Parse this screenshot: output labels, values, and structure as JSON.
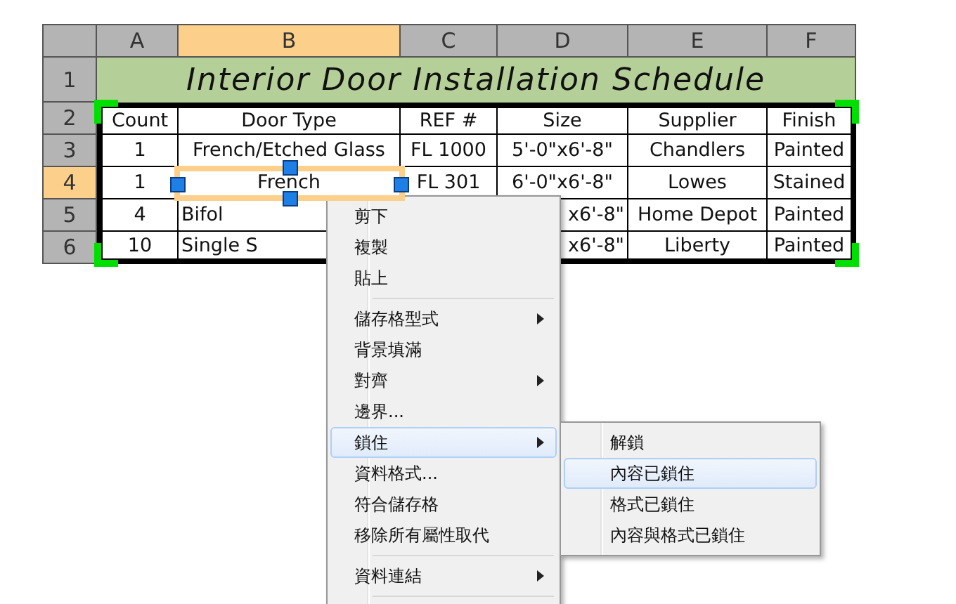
{
  "columns": [
    {
      "label": "A",
      "selected": false
    },
    {
      "label": "B",
      "selected": true
    },
    {
      "label": "C",
      "selected": false
    },
    {
      "label": "D",
      "selected": false
    },
    {
      "label": "E",
      "selected": false
    },
    {
      "label": "F",
      "selected": false
    }
  ],
  "rows": [
    {
      "label": "1",
      "selected": false
    },
    {
      "label": "2",
      "selected": false
    },
    {
      "label": "3",
      "selected": false
    },
    {
      "label": "4",
      "selected": true
    },
    {
      "label": "5",
      "selected": false
    },
    {
      "label": "6",
      "selected": false
    }
  ],
  "title": "Interior Door Installation Schedule",
  "table": [
    {
      "A": {
        "text": "Count",
        "selected": false
      },
      "B": {
        "text": "Door Type",
        "selected": false
      },
      "C": {
        "text": "REF #",
        "selected": false
      },
      "D": {
        "text": "Size",
        "selected": false
      },
      "E": {
        "text": "Supplier",
        "selected": false
      },
      "F": {
        "text": "Finish",
        "selected": false
      }
    },
    {
      "A": {
        "text": "1",
        "selected": false
      },
      "B": {
        "text": "French/Etched Glass",
        "selected": false
      },
      "C": {
        "text": "FL 1000",
        "selected": false
      },
      "D": {
        "text": "5'-0\"x6'-8\"",
        "selected": false
      },
      "E": {
        "text": "Chandlers",
        "selected": false
      },
      "F": {
        "text": "Painted",
        "selected": false
      }
    },
    {
      "A": {
        "text": "1",
        "selected": false
      },
      "B": {
        "text": "French",
        "selected": true
      },
      "C": {
        "text": "FL 301",
        "selected": false
      },
      "D": {
        "text": "6'-0\"x6'-8\"",
        "selected": false
      },
      "E": {
        "text": "Lowes",
        "selected": false
      },
      "F": {
        "text": "Stained",
        "selected": false
      }
    },
    {
      "A": {
        "text": "4",
        "selected": false
      },
      "B": {
        "text": "Bifol",
        "selected": false
      },
      "D": {
        "text": "x6'-8\"",
        "selected": false
      },
      "E": {
        "text": "Home Depot",
        "selected": false
      },
      "F": {
        "text": "Painted",
        "selected": false
      }
    },
    {
      "A": {
        "text": "10",
        "selected": false
      },
      "B": {
        "text": "Single S",
        "selected": false
      },
      "D": {
        "text": "x6'-8\"",
        "selected": false
      },
      "E": {
        "text": "Liberty",
        "selected": false
      },
      "F": {
        "text": "Painted",
        "selected": false
      }
    }
  ],
  "context_menu": [
    {
      "kind": "item",
      "label": "剪下",
      "submenu": false,
      "selected": false
    },
    {
      "kind": "item",
      "label": "複製",
      "submenu": false,
      "selected": false
    },
    {
      "kind": "item",
      "label": "貼上",
      "submenu": false,
      "selected": false
    },
    {
      "kind": "separator"
    },
    {
      "kind": "item",
      "label": "儲存格型式",
      "submenu": true,
      "selected": false
    },
    {
      "kind": "item",
      "label": "背景填滿",
      "submenu": false,
      "selected": false
    },
    {
      "kind": "item",
      "label": "對齊",
      "submenu": true,
      "selected": false
    },
    {
      "kind": "item",
      "label": "邊界...",
      "submenu": false,
      "selected": false
    },
    {
      "kind": "item",
      "label": "鎖住",
      "submenu": true,
      "selected": true,
      "children": [
        {
          "label": "解鎖",
          "selected": false
        },
        {
          "label": "內容已鎖住",
          "selected": true
        },
        {
          "label": "格式已鎖住",
          "selected": false
        },
        {
          "label": "內容與格式已鎖住",
          "selected": false
        }
      ]
    },
    {
      "kind": "item",
      "label": "資料格式...",
      "submenu": false,
      "selected": false
    },
    {
      "kind": "item",
      "label": "符合儲存格",
      "submenu": false,
      "selected": false
    },
    {
      "kind": "item",
      "label": "移除所有屬性取代",
      "submenu": false,
      "selected": false
    },
    {
      "kind": "separator"
    },
    {
      "kind": "item",
      "label": "資料連結",
      "submenu": true,
      "selected": false
    },
    {
      "kind": "separator"
    }
  ]
}
